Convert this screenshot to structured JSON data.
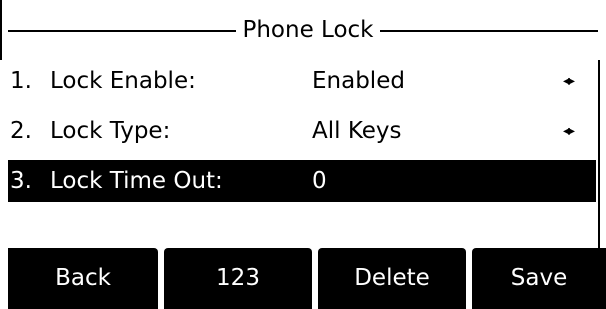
{
  "screen": {
    "title": "Phone Lock"
  },
  "menu": {
    "items": [
      {
        "index": "1.",
        "label": "Lock Enable:",
        "value": "Enabled",
        "arrows": "◂▸",
        "selected": false
      },
      {
        "index": "2.",
        "label": "Lock Type:",
        "value": "All Keys",
        "arrows": "◂▸",
        "selected": false
      },
      {
        "index": "3.",
        "label": "Lock Time Out:",
        "value": "0",
        "arrows": "",
        "selected": true
      }
    ]
  },
  "softkeys": {
    "back": "Back",
    "input_mode": "123",
    "delete": "Delete",
    "save": "Save"
  },
  "colors": {
    "background": "#ffffff",
    "foreground": "#000000",
    "highlight": "#000000",
    "highlight_text": "#ffffff"
  }
}
